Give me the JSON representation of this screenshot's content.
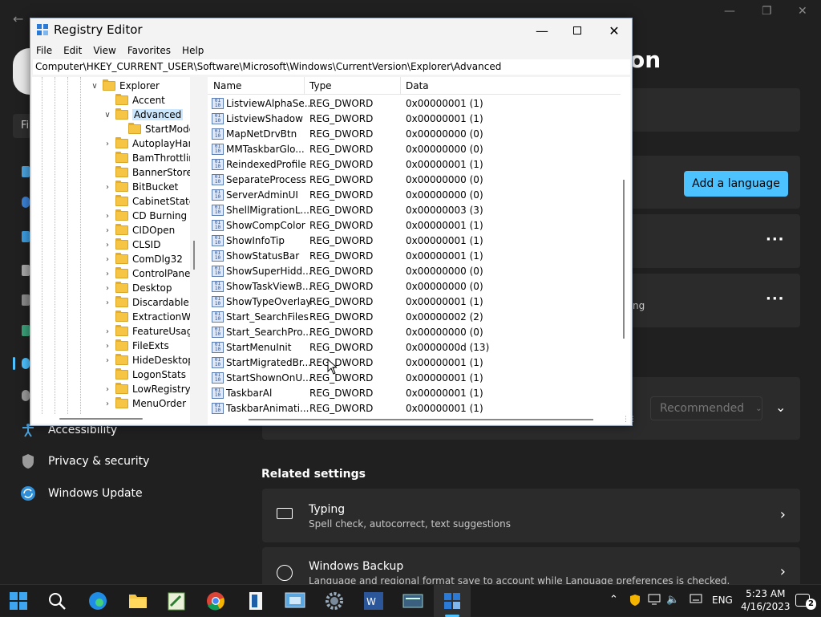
{
  "settings": {
    "page_title_fragment": "on",
    "add_language_label": "Add a language",
    "card2_sub_fragment": "ng",
    "recommended_label": "Recommended",
    "sidebar": [
      {
        "label": "Accessibility"
      },
      {
        "label": "Privacy & security"
      },
      {
        "label": "Windows Update"
      }
    ],
    "related_title": "Related settings",
    "related": [
      {
        "title": "Typing",
        "subtitle": "Spell check, autocorrect, text suggestions"
      },
      {
        "title": "Windows Backup",
        "subtitle": "Language and regional format save to account while Language preferences is checked."
      }
    ],
    "search_fragment": "Fi"
  },
  "registry": {
    "title": "Registry Editor",
    "menu": [
      "File",
      "Edit",
      "View",
      "Favorites",
      "Help"
    ],
    "address": "Computer\\HKEY_CURRENT_USER\\Software\\Microsoft\\Windows\\CurrentVersion\\Explorer\\Advanced",
    "tree": [
      {
        "label": "Explorer",
        "level": 0,
        "expander": "v"
      },
      {
        "label": "Accent",
        "level": 1,
        "expander": ""
      },
      {
        "label": "Advanced",
        "level": 1,
        "expander": "v",
        "selected": true
      },
      {
        "label": "StartMode",
        "level": 2,
        "expander": ""
      },
      {
        "label": "AutoplayHand",
        "level": 1,
        "expander": ">"
      },
      {
        "label": "BamThrottling",
        "level": 1,
        "expander": ""
      },
      {
        "label": "BannerStore",
        "level": 1,
        "expander": ""
      },
      {
        "label": "BitBucket",
        "level": 1,
        "expander": ">"
      },
      {
        "label": "CabinetState",
        "level": 1,
        "expander": ""
      },
      {
        "label": "CD Burning",
        "level": 1,
        "expander": ">"
      },
      {
        "label": "CIDOpen",
        "level": 1,
        "expander": ">"
      },
      {
        "label": "CLSID",
        "level": 1,
        "expander": ">"
      },
      {
        "label": "ComDlg32",
        "level": 1,
        "expander": ">"
      },
      {
        "label": "ControlPanel",
        "level": 1,
        "expander": ">"
      },
      {
        "label": "Desktop",
        "level": 1,
        "expander": ">"
      },
      {
        "label": "Discardable",
        "level": 1,
        "expander": ">"
      },
      {
        "label": "ExtractionWiza",
        "level": 1,
        "expander": ""
      },
      {
        "label": "FeatureUsage",
        "level": 1,
        "expander": ">"
      },
      {
        "label": "FileExts",
        "level": 1,
        "expander": ">"
      },
      {
        "label": "HideDesktopIc",
        "level": 1,
        "expander": ">"
      },
      {
        "label": "LogonStats",
        "level": 1,
        "expander": ""
      },
      {
        "label": "LowRegistry",
        "level": 1,
        "expander": ">"
      },
      {
        "label": "MenuOrder",
        "level": 1,
        "expander": ">"
      }
    ],
    "columns": [
      "Name",
      "Type",
      "Data"
    ],
    "values": [
      {
        "name": "ListviewAlphaSe...",
        "type": "REG_DWORD",
        "data": "0x00000001 (1)"
      },
      {
        "name": "ListviewShadow",
        "type": "REG_DWORD",
        "data": "0x00000001 (1)"
      },
      {
        "name": "MapNetDrvBtn",
        "type": "REG_DWORD",
        "data": "0x00000000 (0)"
      },
      {
        "name": "MMTaskbarGlo...",
        "type": "REG_DWORD",
        "data": "0x00000000 (0)"
      },
      {
        "name": "ReindexedProfile",
        "type": "REG_DWORD",
        "data": "0x00000001 (1)"
      },
      {
        "name": "SeparateProcess",
        "type": "REG_DWORD",
        "data": "0x00000000 (0)"
      },
      {
        "name": "ServerAdminUI",
        "type": "REG_DWORD",
        "data": "0x00000000 (0)"
      },
      {
        "name": "ShellMigrationL...",
        "type": "REG_DWORD",
        "data": "0x00000003 (3)"
      },
      {
        "name": "ShowCompColor",
        "type": "REG_DWORD",
        "data": "0x00000001 (1)"
      },
      {
        "name": "ShowInfoTip",
        "type": "REG_DWORD",
        "data": "0x00000001 (1)"
      },
      {
        "name": "ShowStatusBar",
        "type": "REG_DWORD",
        "data": "0x00000001 (1)"
      },
      {
        "name": "ShowSuperHidd...",
        "type": "REG_DWORD",
        "data": "0x00000000 (0)"
      },
      {
        "name": "ShowTaskViewB...",
        "type": "REG_DWORD",
        "data": "0x00000000 (0)"
      },
      {
        "name": "ShowTypeOverlay",
        "type": "REG_DWORD",
        "data": "0x00000001 (1)"
      },
      {
        "name": "Start_SearchFiles",
        "type": "REG_DWORD",
        "data": "0x00000002 (2)"
      },
      {
        "name": "Start_SearchPro...",
        "type": "REG_DWORD",
        "data": "0x00000000 (0)"
      },
      {
        "name": "StartMenuInit",
        "type": "REG_DWORD",
        "data": "0x0000000d (13)"
      },
      {
        "name": "StartMigratedBr...",
        "type": "REG_DWORD",
        "data": "0x00000001 (1)"
      },
      {
        "name": "StartShownOnU...",
        "type": "REG_DWORD",
        "data": "0x00000001 (1)"
      },
      {
        "name": "TaskbarAl",
        "type": "REG_DWORD",
        "data": "0x00000001 (1)"
      },
      {
        "name": "TaskbarAnimati...",
        "type": "REG_DWORD",
        "data": "0x00000001 (1)"
      }
    ]
  },
  "taskbar": {
    "apps": [
      "start-icon",
      "search-icon",
      "edge-icon",
      "file-explorer-icon",
      "notepad-icon",
      "chrome-icon",
      "book-icon",
      "control-panel-icon",
      "settings-icon",
      "word-icon",
      "screen-icon",
      "regedit-icon"
    ],
    "lang": "ENG",
    "time": "5:23 AM",
    "date": "4/16/2023",
    "notifications": "2"
  },
  "colors": {
    "accent": "#4cc2ff",
    "settings_bg": "#202020",
    "card_bg": "#2b2b2b",
    "folder": "#f5c543"
  }
}
